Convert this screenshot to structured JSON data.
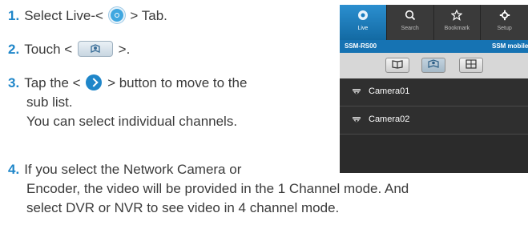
{
  "steps": [
    {
      "num": "1.",
      "before": "Select Live-<",
      "after": "> Tab."
    },
    {
      "num": "2.",
      "before": "Touch <",
      "after": ">."
    },
    {
      "num": "3.",
      "before": "Tap the <",
      "after": "> button to move to the",
      "line2": "sub list.",
      "line3": "You can select individual channels."
    },
    {
      "num": "4.",
      "line1": "If you select the Network Camera or",
      "line2": "Encoder, the video will be provided in the 1 Channel mode. And",
      "line3": "select DVR or NVR to see video in 4 channel mode."
    }
  ],
  "phone": {
    "tabs": [
      {
        "label": "Live",
        "icon": "live-icon"
      },
      {
        "label": "Search",
        "icon": "search-icon"
      },
      {
        "label": "Bookmark",
        "icon": "star-icon"
      },
      {
        "label": "Setup",
        "icon": "gear-icon"
      }
    ],
    "site_name": "SSM-RS00",
    "site_right": "SSM mobile",
    "toolbar_buttons": [
      "book-view-icon",
      "map-view-icon",
      "grid-view-icon"
    ],
    "cameras": [
      "Camera01",
      "Camera02"
    ]
  },
  "colors": {
    "accent": "#1f86c9",
    "tab_active": "#1a7ec0",
    "site_bar": "#1673b3"
  }
}
